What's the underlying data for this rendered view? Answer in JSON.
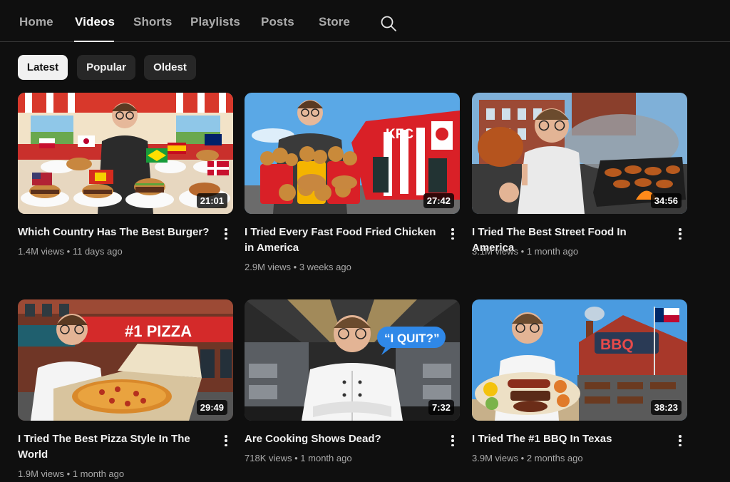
{
  "tabs": [
    {
      "label": "Home"
    },
    {
      "label": "Videos"
    },
    {
      "label": "Shorts"
    },
    {
      "label": "Playlists"
    },
    {
      "label": "Posts"
    },
    {
      "label": "Store"
    }
  ],
  "active_tab": "Videos",
  "search_icon": "search-icon",
  "chips": [
    {
      "label": "Latest"
    },
    {
      "label": "Popular"
    },
    {
      "label": "Oldest"
    }
  ],
  "active_chip": "Latest",
  "videos": [
    {
      "title": "Which Country Has The Best Burger?",
      "duration": "21:01",
      "views": "1.4M views",
      "age": "11 days ago"
    },
    {
      "title": "I Tried Every Fast Food Fried Chicken in America",
      "duration": "27:42",
      "views": "2.9M views",
      "age": "3 weeks ago",
      "sign": "KFC"
    },
    {
      "title": "I Tried The Best Street Food In America",
      "duration": "34:56",
      "views": "3.1M views",
      "age": "1 month ago"
    },
    {
      "title": "I Tried The Best Pizza Style In The World",
      "duration": "29:49",
      "views": "1.9M views",
      "age": "1 month ago",
      "sign": "#1 PIZZA"
    },
    {
      "title": "Are Cooking Shows Dead?",
      "duration": "7:32",
      "views": "718K views",
      "age": "1 month ago",
      "sign": "“I QUIT?”"
    },
    {
      "title": "I Tried The #1 BBQ In Texas",
      "duration": "38:23",
      "views": "3.9M views",
      "age": "2 months ago",
      "sign": "BBQ"
    }
  ],
  "meta_separator": "•",
  "colors": {
    "background": "#0f0f0f",
    "chip": "#272727",
    "chip_active": "#f1f1f1",
    "secondary_text": "#aaaaaa"
  }
}
